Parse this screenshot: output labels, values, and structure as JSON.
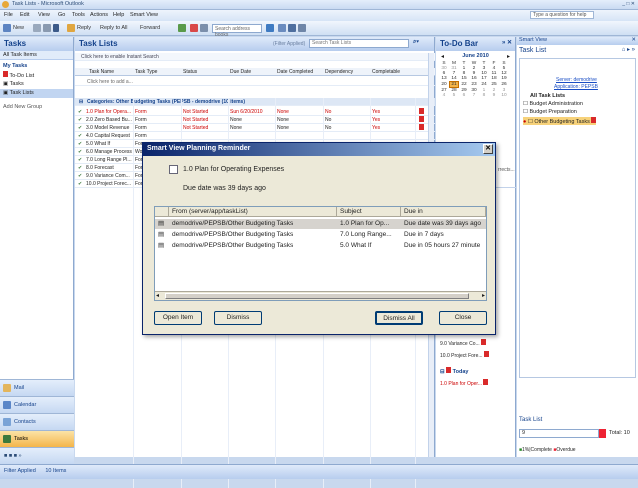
{
  "window": {
    "title": "Task Lists - Microsoft Outlook",
    "ask_box": "Type a question for help"
  },
  "menu": [
    "File",
    "Edit",
    "View",
    "Go",
    "Tools",
    "Actions",
    "Help",
    "Smart View"
  ],
  "toolbar": {
    "new": "New",
    "todo": "Reply",
    "reply_all": "Reply to All",
    "forward": "Forward",
    "search_placeholder": "Search address books"
  },
  "nav": {
    "header": "Tasks",
    "all_task_items": "All Task Items",
    "my_tasks_header": "My Tasks",
    "items": [
      "To-Do List",
      "Tasks",
      "Task Lists"
    ],
    "add_group": "Add New Group",
    "buttons": [
      "Mail",
      "Calendar",
      "Contacts",
      "Tasks"
    ]
  },
  "tasklist": {
    "header": "Task Lists",
    "filter": "(Filter Applied)",
    "search_placeholder": "Search Task Lists",
    "instant_search": "Click here to enable Instant Search",
    "columns": [
      "Task Name",
      "Task Type",
      "Status",
      "Due Date",
      "Date Completed",
      "Dependency",
      "Completable"
    ],
    "add_row": "Click here to add a...",
    "category": "Categories: Other Budgeting Tasks (PEPSB - demodrive (10 items)",
    "rows": [
      {
        "name": "1.0 Plan for Opera...",
        "type": "Form",
        "status": "Not Started",
        "due": "Sun 6/20/2010",
        "completed": "None",
        "dep": "No",
        "comp": "Yes"
      },
      {
        "name": "2.0 Zero Based Bu...",
        "type": "Form",
        "status": "Not Started",
        "due": "None",
        "completed": "None",
        "dep": "No",
        "comp": "Yes"
      },
      {
        "name": "3.0 Model Revenue",
        "type": "Form",
        "status": "Not Started",
        "due": "None",
        "completed": "None",
        "dep": "No",
        "comp": "Yes"
      },
      {
        "name": "4.0 Capital Request",
        "type": "Form",
        "status": "",
        "due": "",
        "completed": "",
        "dep": "",
        "comp": ""
      },
      {
        "name": "5.0 What If",
        "type": "Form",
        "status": "",
        "due": "",
        "completed": "",
        "dep": "",
        "comp": ""
      },
      {
        "name": "6.0 Manage Process",
        "type": "Wo",
        "status": "",
        "due": "",
        "completed": "",
        "dep": "",
        "comp": ""
      },
      {
        "name": "7.0 Long Range Pl...",
        "type": "Form",
        "status": "",
        "due": "",
        "completed": "",
        "dep": "",
        "comp": ""
      },
      {
        "name": "8.0 Forecast",
        "type": "Form",
        "status": "",
        "due": "",
        "completed": "",
        "dep": "",
        "comp": ""
      },
      {
        "name": "9.0 Variance Com...",
        "type": "Form",
        "status": "",
        "due": "",
        "completed": "",
        "dep": "",
        "comp": ""
      },
      {
        "name": "10.0 Project Forec...",
        "type": "Form",
        "status": "",
        "due": "",
        "completed": "",
        "dep": "",
        "comp": ""
      }
    ]
  },
  "todobar": {
    "header": "To-Do Bar",
    "month": "June 2010",
    "days": [
      "S",
      "M",
      "T",
      "W",
      "T",
      "F",
      "S"
    ],
    "weeks": [
      [
        "30",
        "31",
        "1",
        "2",
        "3",
        "4",
        "5"
      ],
      [
        "6",
        "7",
        "8",
        "9",
        "10",
        "11",
        "12"
      ],
      [
        "13",
        "14",
        "15",
        "16",
        "17",
        "18",
        "19"
      ],
      [
        "20",
        "21",
        "22",
        "23",
        "24",
        "25",
        "26"
      ],
      [
        "27",
        "28",
        "29",
        "30",
        "1",
        "2",
        "3"
      ],
      [
        "4",
        "5",
        "6",
        "7",
        "8",
        "9",
        "10"
      ]
    ],
    "today_cell": "21",
    "side_label": "rrects...",
    "tasks": [
      "9.0 Variance Co...",
      "10.0 Project Fore..."
    ],
    "today_label": "Today",
    "today_task": "1.0 Plan for Oper..."
  },
  "smartview": {
    "header": "Smart View",
    "tasklist_title": "Task List",
    "server_link": "Server: demodrive",
    "app_link": "Application: PEPSB",
    "tree_root": "All Task Lists",
    "tree_items": [
      "Budget Administration",
      "Budget Preparation",
      "Other Budgeting Tasks"
    ],
    "bottom_title": "Task List",
    "count": "9",
    "total": "Total: 10",
    "legend_complete": "1%|Complete",
    "legend_overdue": "Overdue"
  },
  "statusbar": {
    "filter": "Filter Applied",
    "items": "10 Items"
  },
  "dialog": {
    "title": "Smart View Planning Reminder",
    "task_name": "1.0 Plan for Operating Expenses",
    "due_text": "Due date was 39 days ago",
    "columns": [
      "From (server/app/taskList)",
      "Subject",
      "Due in"
    ],
    "rows": [
      {
        "from": "demodrive/PEPSB/Other Budgeting Tasks",
        "subject": "1.0 Plan for Op...",
        "due": "Due date was 39 days ago"
      },
      {
        "from": "demodrive/PEPSB/Other Budgeting Tasks",
        "subject": "7.0 Long Range...",
        "due": "Due in 7 days"
      },
      {
        "from": "demodrive/PEPSB/Other Budgeting Tasks",
        "subject": "5.0 What If",
        "due": "Due in 05 hours 27 minute"
      }
    ],
    "buttons": {
      "open": "Open Item",
      "dismiss": "Dismiss",
      "dismiss_all": "Dismiss All",
      "close": "Close"
    }
  },
  "colors": {
    "accent": "#15428b",
    "dialog_title": "#0a246a",
    "flag": "#d92a2a",
    "selected": "#f4b54a"
  }
}
